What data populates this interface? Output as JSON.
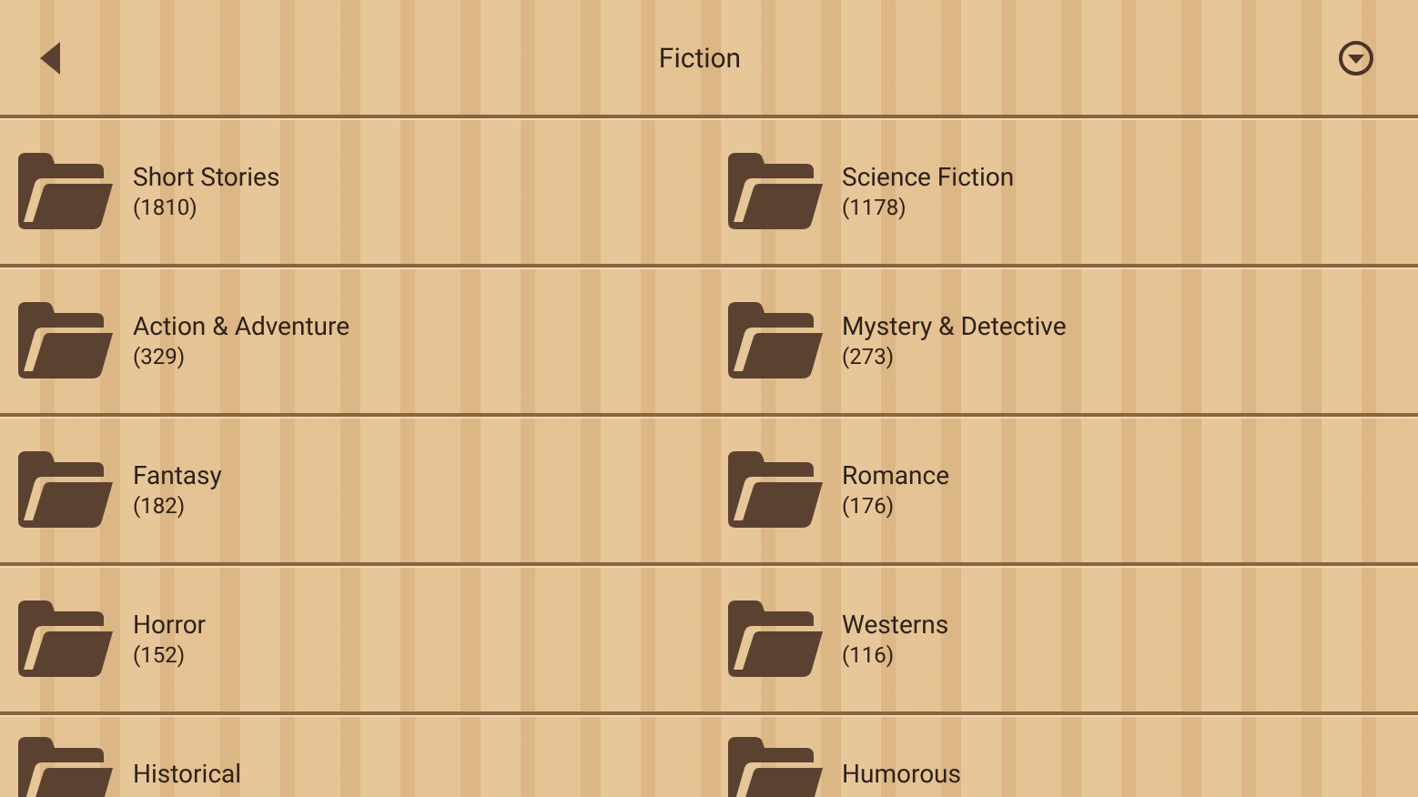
{
  "header": {
    "title": "Fiction"
  },
  "categories": [
    {
      "name": "Short Stories",
      "count": "(1810)"
    },
    {
      "name": "Science Fiction",
      "count": "(1178)"
    },
    {
      "name": "Action & Adventure",
      "count": "(329)"
    },
    {
      "name": "Mystery & Detective",
      "count": "(273)"
    },
    {
      "name": "Fantasy",
      "count": "(182)"
    },
    {
      "name": "Romance",
      "count": "(176)"
    },
    {
      "name": "Horror",
      "count": "(152)"
    },
    {
      "name": "Westerns",
      "count": "(116)"
    },
    {
      "name": "Historical"
    },
    {
      "name": "Humorous"
    }
  ]
}
